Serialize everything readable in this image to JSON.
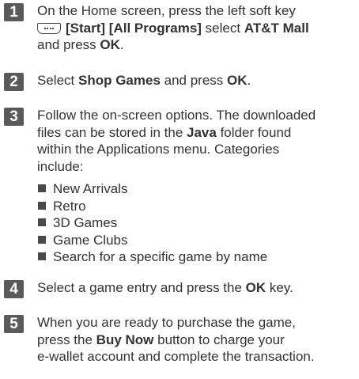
{
  "steps": [
    {
      "num": "1",
      "l1": "On the Home screen, press the left soft key",
      "l2_start": "[Start]",
      "l2_all": "[All Programs]",
      "l2_mid": "select",
      "l2_mall": "AT&T Mall",
      "l3_pre": "and press",
      "l3_ok": "OK",
      "l3_end": "."
    },
    {
      "num": "2",
      "pre": "Select",
      "bold1": "Shop Games",
      "mid": "and press",
      "bold2": "OK",
      "end": "."
    },
    {
      "num": "3",
      "l1": "Follow the on-screen options. The downloaded",
      "l2_pre": "files can be stored in the",
      "l2_bold": "Java",
      "l2_post": "folder found",
      "l3": "within the Applications menu. Categories",
      "l4": "include:",
      "categories": [
        "New Arrivals",
        "Retro",
        "3D Games",
        "Game Clubs",
        "Search for a specific game by name"
      ]
    },
    {
      "num": "4",
      "pre": "Select a game entry and press the",
      "bold": "OK",
      "post": "key."
    },
    {
      "num": "5",
      "l1": "When you are ready to purchase the game,",
      "l2_pre": "press the",
      "l2_bold": "Buy Now",
      "l2_post": "button to charge your",
      "l3": "e-wallet account and complete the transaction."
    }
  ],
  "icons": {
    "soft_key": "left-soft-key-icon",
    "bullet": "square-bullet-icon",
    "colors": {
      "badge": "#5a5a5a",
      "text": "#333333"
    }
  }
}
